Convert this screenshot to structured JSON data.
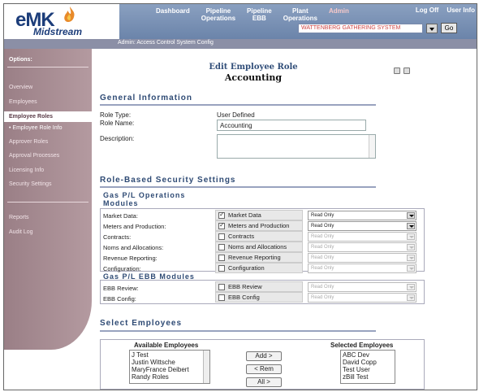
{
  "app": {
    "logo_main": "eMK",
    "logo_sub": "Midstream"
  },
  "nav": {
    "items": [
      {
        "label": "Dashboard"
      },
      {
        "label": "Pipeline\nOperations"
      },
      {
        "label": "Pipeline\nEBB"
      },
      {
        "label": "Plant\nOperations"
      },
      {
        "label": "Admin"
      }
    ],
    "logoff": "Log Off",
    "userinfo": "User Info"
  },
  "system_selector": {
    "value": "WATTENBERG GATHERING SYSTEM",
    "go": "Go"
  },
  "breadcrumb": "Admin:  Access Control System Config",
  "sidebar": {
    "title": "Options:",
    "items": [
      "Overview",
      "Employees",
      "Employee Roles",
      "Approver Roles",
      "Approval Processes",
      "Licensing Info",
      "Security Settings",
      "Reports",
      "Audit Log"
    ],
    "sub_item": "• Employee Role Info"
  },
  "page": {
    "title": "Edit Employee Role",
    "subtitle": "Accounting"
  },
  "general": {
    "title": "General Information",
    "role_type_label": "Role Type:",
    "role_type_value": "User Defined",
    "role_name_label": "Role Name:",
    "role_name_value": "Accounting",
    "description_label": "Description:"
  },
  "security": {
    "title": "Role-Based Security Settings",
    "gas_ops_title": "Gas P/L Operations\nModules",
    "gas_ops_rows": [
      {
        "label": "Market Data:",
        "check_label": "Market Data",
        "checked": true,
        "access": "Read Only",
        "enabled": true
      },
      {
        "label": "Meters and Production:",
        "check_label": "Meters and Production",
        "checked": true,
        "access": "Read Only",
        "enabled": true
      },
      {
        "label": "Contracts:",
        "check_label": "Contracts",
        "checked": false,
        "access": "Read Only",
        "enabled": false
      },
      {
        "label": "Noms and Allocations:",
        "check_label": "Noms and Allocations",
        "checked": false,
        "access": "Read Only",
        "enabled": false
      },
      {
        "label": "Revenue Reporting:",
        "check_label": "Revenue Reporting",
        "checked": false,
        "access": "Read Only",
        "enabled": false
      },
      {
        "label": "Configuration:",
        "check_label": "Configuration",
        "checked": false,
        "access": "Read Only",
        "enabled": false
      }
    ],
    "ebb_title": "Gas P/L EBB Modules",
    "ebb_rows": [
      {
        "label": "EBB Review:",
        "check_label": "EBB Review",
        "checked": false,
        "access": "Read Only",
        "enabled": false
      },
      {
        "label": "EBB Config:",
        "check_label": "EBB Config",
        "checked": false,
        "access": "Read Only",
        "enabled": false
      }
    ]
  },
  "employees": {
    "title": "Select Employees",
    "available_label": "Available Employees",
    "selected_label": "Selected Employees",
    "available": [
      "J Test",
      "Justin Wittsche",
      "MaryFrance Deibert",
      "Randy Roles"
    ],
    "selected": [
      "ABC Dev",
      "David Copp",
      "Test User",
      "zBill Test"
    ],
    "add_btn": "Add >",
    "rem_btn": "< Rem",
    "all_btn": "All >"
  }
}
